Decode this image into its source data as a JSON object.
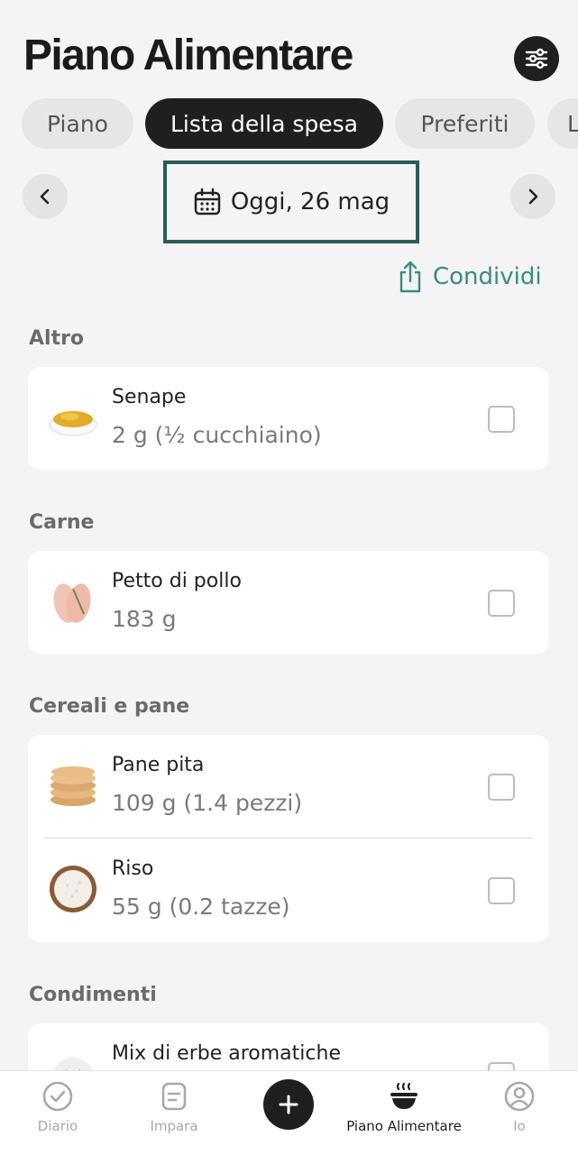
{
  "header": {
    "title": "Piano Alimentare"
  },
  "tabs": [
    {
      "label": "Piano"
    },
    {
      "label": "Lista della spesa",
      "active": true
    },
    {
      "label": "Preferiti"
    },
    {
      "label": "L"
    }
  ],
  "date_nav": {
    "label": "Oggi, 26 mag"
  },
  "share": {
    "label": "Condividi"
  },
  "sections": [
    {
      "name": "Altro",
      "items": [
        {
          "name": "Senape",
          "qty": "2 g (½ cucchiaino)",
          "checked": false
        }
      ]
    },
    {
      "name": "Carne",
      "items": [
        {
          "name": "Petto di pollo",
          "qty": "183 g",
          "checked": false
        }
      ]
    },
    {
      "name": "Cereali e pane",
      "items": [
        {
          "name": "Pane pita",
          "qty": "109 g (1.4 pezzi)",
          "checked": false
        },
        {
          "name": "Riso",
          "qty": "55 g (0.2 tazze)",
          "checked": false
        }
      ]
    },
    {
      "name": "Condimenti",
      "items": [
        {
          "name": "Mix di erbe aromatiche",
          "qty": "",
          "checked": false
        }
      ]
    }
  ],
  "bottom_nav": [
    {
      "label": "Diario",
      "icon": "check-circle-icon"
    },
    {
      "label": "Impara",
      "icon": "document-icon"
    },
    {
      "label": "",
      "icon": "plus-icon"
    },
    {
      "label": "Piano Alimentare",
      "icon": "food-bowl-icon",
      "active": true
    },
    {
      "label": "Io",
      "icon": "user-icon"
    }
  ],
  "colors": {
    "accent": "#3a8b80",
    "dark": "#1f1f1f",
    "highlight_border": "#2c5c58"
  }
}
